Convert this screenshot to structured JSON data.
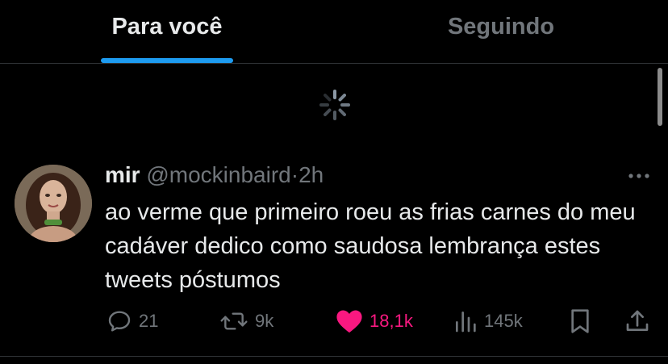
{
  "tabs": [
    {
      "label": "Para você",
      "active": true
    },
    {
      "label": "Seguindo",
      "active": false
    }
  ],
  "tweet": {
    "author_name": "mir",
    "handle": "@mockinbaird",
    "separator": "·",
    "time": "2h",
    "text": "ao verme que primeiro roeu as frias carnes do meu cadáver dedico como saudosa lembrança estes tweets póstumos",
    "actions": {
      "replies": "21",
      "retweets": "9k",
      "likes": "18,1k",
      "views": "145k"
    }
  },
  "colors": {
    "accent": "#1d9bf0",
    "like": "#f91880",
    "muted": "#71767b",
    "text": "#e7e9ea",
    "border": "#2f3336"
  },
  "icons": [
    "spinner-icon",
    "more-icon",
    "reply-icon",
    "retweet-icon",
    "like-icon",
    "views-icon",
    "bookmark-icon",
    "share-icon"
  ]
}
